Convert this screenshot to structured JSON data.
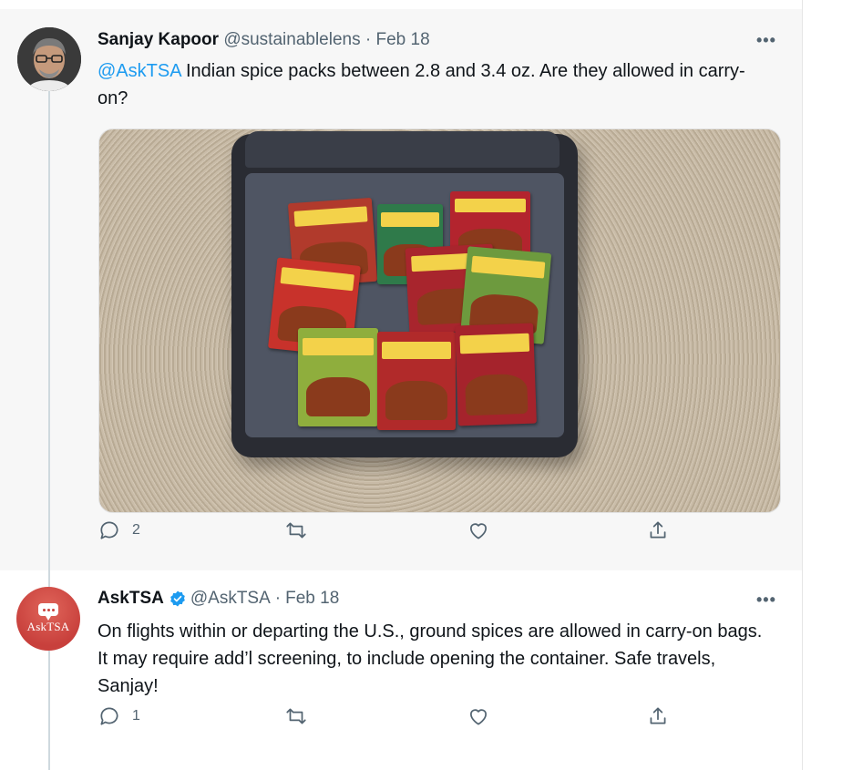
{
  "tweets": [
    {
      "author_name": "Sanjay Kapoor",
      "handle": "@sustainablelens",
      "separator": "·",
      "date": "Feb 18",
      "mention": "@AskTSA",
      "text": " Indian spice packs between 2.8 and 3.4 oz. Are they allowed in carry-on?",
      "more": "•••",
      "reply_count": "2",
      "retweet_count": "",
      "like_count": ""
    },
    {
      "author_name": "AskTSA",
      "handle": "@AskTSA",
      "separator": "·",
      "date": "Feb 18",
      "avatar_text": "AskTSA",
      "text": "On flights within or departing the U.S., ground spices  are allowed in carry-on bags. It may require add’l screening, to include opening the container. Safe travels, Sanjay!",
      "more": "•••",
      "reply_count": "1",
      "retweet_count": "",
      "like_count": ""
    }
  ],
  "icons": {
    "reply": "reply-icon",
    "retweet": "retweet-icon",
    "like": "heart-icon",
    "share": "share-icon",
    "verified": "verified-badge-icon",
    "more": "more-icon"
  },
  "colors": {
    "accent": "#1d9bf0",
    "muted": "#536471",
    "askTsaRed": "#c8403c"
  }
}
